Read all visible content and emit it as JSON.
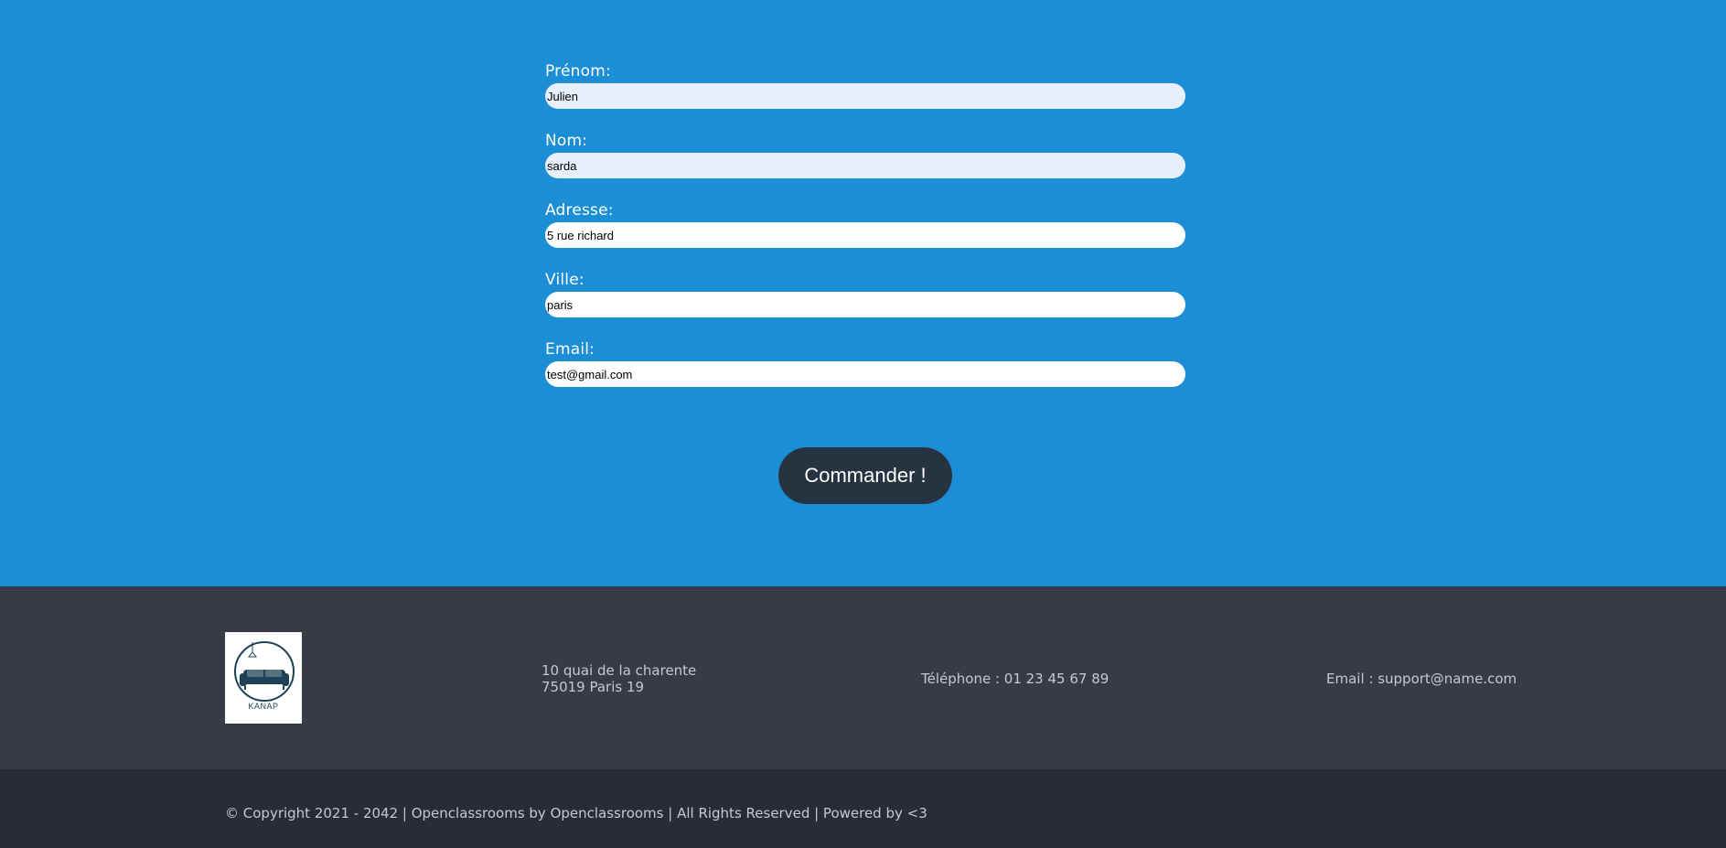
{
  "form": {
    "fields": [
      {
        "label": "Prénom:",
        "value": "Julien"
      },
      {
        "label": "Nom:",
        "value": "sarda"
      },
      {
        "label": "Adresse:",
        "value": "5 rue richard"
      },
      {
        "label": "Ville:",
        "value": "paris"
      },
      {
        "label": "Email:",
        "value": "test@gmail.com"
      }
    ],
    "submit_label": "Commander !"
  },
  "footer": {
    "logo_text": "KANAP",
    "address_line1": "10 quai de la charente",
    "address_line2": "75019 Paris 19",
    "phone": "Téléphone : 01 23 45 67 89",
    "email": "Email : support@name.com",
    "copyright": "© Copyright 2021 - 2042 | Openclassrooms by Openclassrooms | All Rights Reserved | Powered by <3"
  },
  "colors": {
    "page_blue": "#1b8ed6",
    "button": "#263340",
    "footer": "#383b45",
    "footer_bottom": "#292b36",
    "logo_teal": "#1f4356"
  },
  "icons": {
    "logo": "sofa-lamp-icon"
  }
}
